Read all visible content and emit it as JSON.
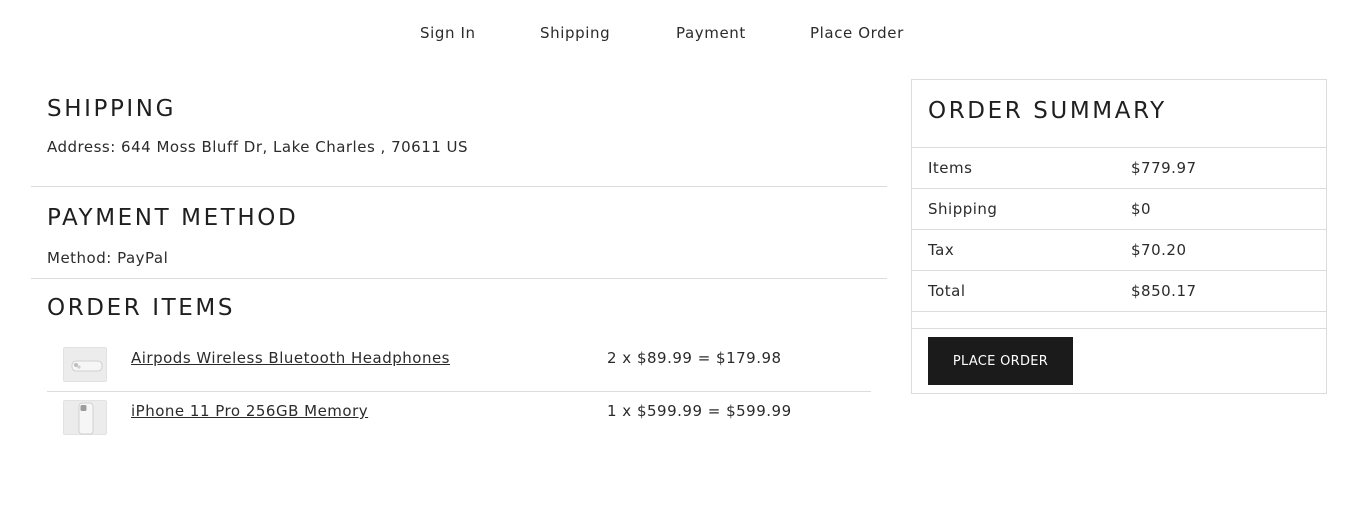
{
  "steps": {
    "sign_in": "Sign In",
    "shipping": "Shipping",
    "payment": "Payment",
    "place_order": "Place Order"
  },
  "shipping": {
    "title": "SHIPPING",
    "address": "Address: 644 Moss Bluff Dr, Lake Charles , 70611 US"
  },
  "payment": {
    "title": "PAYMENT METHOD",
    "method": "Method: PayPal"
  },
  "order_items": {
    "title": "ORDER ITEMS",
    "items": [
      {
        "name": "Airpods Wireless Bluetooth Headphones",
        "price_line": "2 x $89.99 = $179.98",
        "thumb_icon": "airpods-image"
      },
      {
        "name": "iPhone 11 Pro 256GB Memory",
        "price_line": "1 x $599.99 = $599.99",
        "thumb_icon": "iphone-image"
      }
    ]
  },
  "summary": {
    "title": "ORDER SUMMARY",
    "rows": [
      {
        "label": "Items",
        "value": "$779.97"
      },
      {
        "label": "Shipping",
        "value": "$0"
      },
      {
        "label": "Tax",
        "value": "$70.20"
      },
      {
        "label": "Total",
        "value": "$850.17"
      }
    ],
    "button_label": "PLACE ORDER"
  },
  "colors": {
    "button_bg": "#1b1b1b",
    "divider": "#dcdcdc",
    "text": "#2b2b2b"
  }
}
